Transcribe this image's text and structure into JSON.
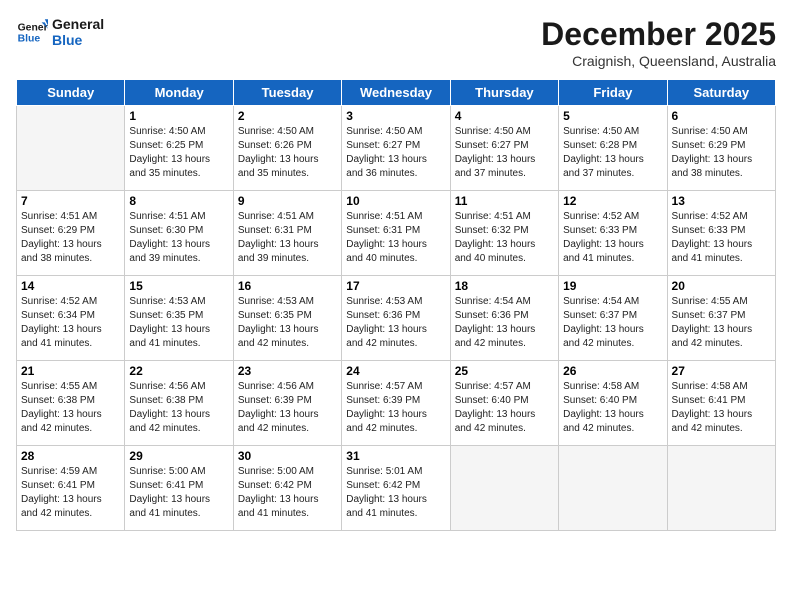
{
  "header": {
    "logo_line1": "General",
    "logo_line2": "Blue",
    "month": "December 2025",
    "location": "Craignish, Queensland, Australia"
  },
  "days_of_week": [
    "Sunday",
    "Monday",
    "Tuesday",
    "Wednesday",
    "Thursday",
    "Friday",
    "Saturday"
  ],
  "weeks": [
    [
      {
        "day": "",
        "content": ""
      },
      {
        "day": "1",
        "content": "Sunrise: 4:50 AM\nSunset: 6:25 PM\nDaylight: 13 hours\nand 35 minutes."
      },
      {
        "day": "2",
        "content": "Sunrise: 4:50 AM\nSunset: 6:26 PM\nDaylight: 13 hours\nand 35 minutes."
      },
      {
        "day": "3",
        "content": "Sunrise: 4:50 AM\nSunset: 6:27 PM\nDaylight: 13 hours\nand 36 minutes."
      },
      {
        "day": "4",
        "content": "Sunrise: 4:50 AM\nSunset: 6:27 PM\nDaylight: 13 hours\nand 37 minutes."
      },
      {
        "day": "5",
        "content": "Sunrise: 4:50 AM\nSunset: 6:28 PM\nDaylight: 13 hours\nand 37 minutes."
      },
      {
        "day": "6",
        "content": "Sunrise: 4:50 AM\nSunset: 6:29 PM\nDaylight: 13 hours\nand 38 minutes."
      }
    ],
    [
      {
        "day": "7",
        "content": "Sunrise: 4:51 AM\nSunset: 6:29 PM\nDaylight: 13 hours\nand 38 minutes."
      },
      {
        "day": "8",
        "content": "Sunrise: 4:51 AM\nSunset: 6:30 PM\nDaylight: 13 hours\nand 39 minutes."
      },
      {
        "day": "9",
        "content": "Sunrise: 4:51 AM\nSunset: 6:31 PM\nDaylight: 13 hours\nand 39 minutes."
      },
      {
        "day": "10",
        "content": "Sunrise: 4:51 AM\nSunset: 6:31 PM\nDaylight: 13 hours\nand 40 minutes."
      },
      {
        "day": "11",
        "content": "Sunrise: 4:51 AM\nSunset: 6:32 PM\nDaylight: 13 hours\nand 40 minutes."
      },
      {
        "day": "12",
        "content": "Sunrise: 4:52 AM\nSunset: 6:33 PM\nDaylight: 13 hours\nand 41 minutes."
      },
      {
        "day": "13",
        "content": "Sunrise: 4:52 AM\nSunset: 6:33 PM\nDaylight: 13 hours\nand 41 minutes."
      }
    ],
    [
      {
        "day": "14",
        "content": "Sunrise: 4:52 AM\nSunset: 6:34 PM\nDaylight: 13 hours\nand 41 minutes."
      },
      {
        "day": "15",
        "content": "Sunrise: 4:53 AM\nSunset: 6:35 PM\nDaylight: 13 hours\nand 41 minutes."
      },
      {
        "day": "16",
        "content": "Sunrise: 4:53 AM\nSunset: 6:35 PM\nDaylight: 13 hours\nand 42 minutes."
      },
      {
        "day": "17",
        "content": "Sunrise: 4:53 AM\nSunset: 6:36 PM\nDaylight: 13 hours\nand 42 minutes."
      },
      {
        "day": "18",
        "content": "Sunrise: 4:54 AM\nSunset: 6:36 PM\nDaylight: 13 hours\nand 42 minutes."
      },
      {
        "day": "19",
        "content": "Sunrise: 4:54 AM\nSunset: 6:37 PM\nDaylight: 13 hours\nand 42 minutes."
      },
      {
        "day": "20",
        "content": "Sunrise: 4:55 AM\nSunset: 6:37 PM\nDaylight: 13 hours\nand 42 minutes."
      }
    ],
    [
      {
        "day": "21",
        "content": "Sunrise: 4:55 AM\nSunset: 6:38 PM\nDaylight: 13 hours\nand 42 minutes."
      },
      {
        "day": "22",
        "content": "Sunrise: 4:56 AM\nSunset: 6:38 PM\nDaylight: 13 hours\nand 42 minutes."
      },
      {
        "day": "23",
        "content": "Sunrise: 4:56 AM\nSunset: 6:39 PM\nDaylight: 13 hours\nand 42 minutes."
      },
      {
        "day": "24",
        "content": "Sunrise: 4:57 AM\nSunset: 6:39 PM\nDaylight: 13 hours\nand 42 minutes."
      },
      {
        "day": "25",
        "content": "Sunrise: 4:57 AM\nSunset: 6:40 PM\nDaylight: 13 hours\nand 42 minutes."
      },
      {
        "day": "26",
        "content": "Sunrise: 4:58 AM\nSunset: 6:40 PM\nDaylight: 13 hours\nand 42 minutes."
      },
      {
        "day": "27",
        "content": "Sunrise: 4:58 AM\nSunset: 6:41 PM\nDaylight: 13 hours\nand 42 minutes."
      }
    ],
    [
      {
        "day": "28",
        "content": "Sunrise: 4:59 AM\nSunset: 6:41 PM\nDaylight: 13 hours\nand 42 minutes."
      },
      {
        "day": "29",
        "content": "Sunrise: 5:00 AM\nSunset: 6:41 PM\nDaylight: 13 hours\nand 41 minutes."
      },
      {
        "day": "30",
        "content": "Sunrise: 5:00 AM\nSunset: 6:42 PM\nDaylight: 13 hours\nand 41 minutes."
      },
      {
        "day": "31",
        "content": "Sunrise: 5:01 AM\nSunset: 6:42 PM\nDaylight: 13 hours\nand 41 minutes."
      },
      {
        "day": "",
        "content": ""
      },
      {
        "day": "",
        "content": ""
      },
      {
        "day": "",
        "content": ""
      }
    ]
  ]
}
